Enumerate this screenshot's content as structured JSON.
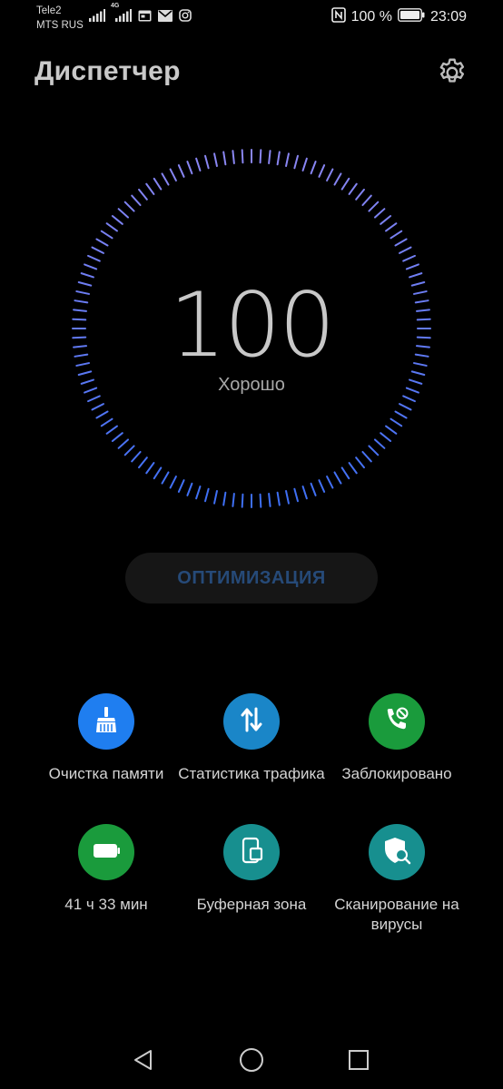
{
  "status_bar": {
    "carrier_1": "Tele2",
    "carrier_2": "MTS RUS",
    "network_type": "4G",
    "battery_percent": "100 %",
    "time": "23:09"
  },
  "header": {
    "title": "Диспетчер"
  },
  "score": {
    "value": "100",
    "status": "Хорошо",
    "ring_color": "#7f7ff0"
  },
  "optimize_button": {
    "label": "ОПТИМИЗАЦИЯ"
  },
  "tools": [
    {
      "label": "Очистка памяти",
      "icon": "broom-icon",
      "color": "#1f7ef0"
    },
    {
      "label": "Статистика трафика",
      "icon": "traffic-arrows-icon",
      "color": "#1a86c8"
    },
    {
      "label": "Заблокировано",
      "icon": "blocked-call-icon",
      "color": "#1a9b3c"
    },
    {
      "label": "41 ч 33 мин",
      "icon": "battery-icon",
      "color": "#1a9b3c"
    },
    {
      "label": "Буферная зона",
      "icon": "app-twin-icon",
      "color": "#178f8f"
    },
    {
      "label": "Сканирование на вирусы",
      "icon": "virus-scan-icon",
      "color": "#178f8f"
    }
  ],
  "nav": {
    "back": "back-icon",
    "home": "home-icon",
    "recents": "recents-icon"
  }
}
